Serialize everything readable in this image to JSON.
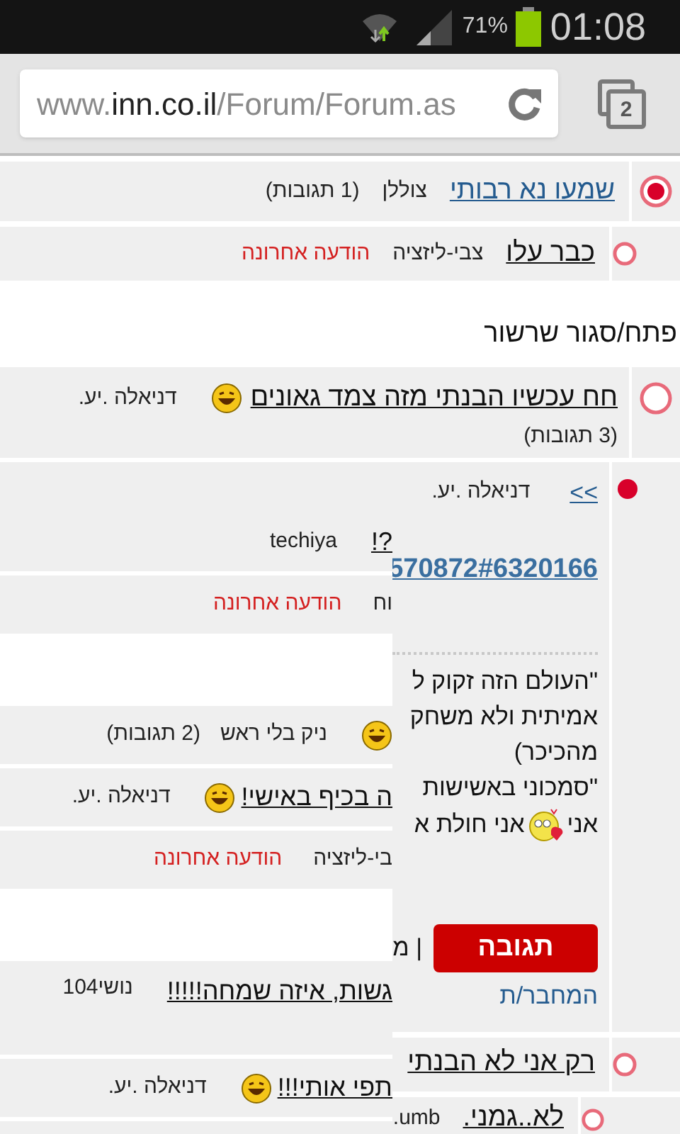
{
  "status_bar": {
    "battery_percent": "71%",
    "time": "01:08"
  },
  "browser": {
    "url_prefix": "www.",
    "url_host": "inn.co.il",
    "url_path": "/Forum/Forum.as",
    "tab_count": "2"
  },
  "rows": [
    {
      "kind": "topic",
      "selected": true,
      "title": "שמעו נא רבותי",
      "visited": false,
      "author": "צוללן",
      "replies": "(1 תגובות)"
    },
    {
      "kind": "reply",
      "selected": false,
      "title": "כבר עלו",
      "visited": true,
      "author": "צבי-ליזציה",
      "last_message": "הודעה אחרונה"
    },
    {
      "kind": "toggle",
      "label": "פתח/סגור שרשור"
    },
    {
      "kind": "topic_wrap",
      "selected": false,
      "title": "חח עכשיו הבנתי מזה צמד גאונים",
      "visited": true,
      "emoji": true,
      "author": "דניאלה .יע.",
      "replies": "(3 תגובות)"
    },
    {
      "kind": "post",
      "back_link": ">>",
      "author": "דניאלה .יע.",
      "link": "570872#6320166",
      "quote_lines": [
        "\"העולם הזה זקוק ל",
        "אמיתית ולא משחק",
        "מהכיכר)",
        "\"סמכוני באשישות"
      ],
      "last_line_start": "אני",
      "last_line_end": "אני חולת א",
      "reply_button": "תגובה",
      "separator": "| מ",
      "author_link": "המחבר/ת"
    },
    {
      "kind": "reply",
      "selected": false,
      "title": "רק אני לא הבנתי",
      "visited": true
    },
    {
      "kind": "reply_small",
      "selected": false,
      "title": "לא..גמני.",
      "visited": true,
      "author": "umb."
    }
  ],
  "overlay_rows": [
    {
      "kind": "row",
      "title": "?!",
      "author": "techiya"
    },
    {
      "kind": "row",
      "author": "וח",
      "last_message": "הודעה אחרונה"
    },
    {
      "kind": "blank"
    },
    {
      "kind": "row",
      "emoji": true,
      "author": "ניק בלי ראש",
      "replies": "(2 תגובות)"
    },
    {
      "kind": "row",
      "title": "ה בכיף באישי!",
      "emoji": true,
      "author": "דניאלה .יע."
    },
    {
      "kind": "row",
      "author": "בי-ליזציה",
      "last_message": "הודעה אחרונה"
    },
    {
      "kind": "blank"
    },
    {
      "kind": "tall",
      "title": "גשות, איזה שמחה!!!!!",
      "author": "נושי104"
    },
    {
      "kind": "row",
      "title": "תפי אותי!!!",
      "emoji": true,
      "author": "דניאלה .יע."
    }
  ]
}
